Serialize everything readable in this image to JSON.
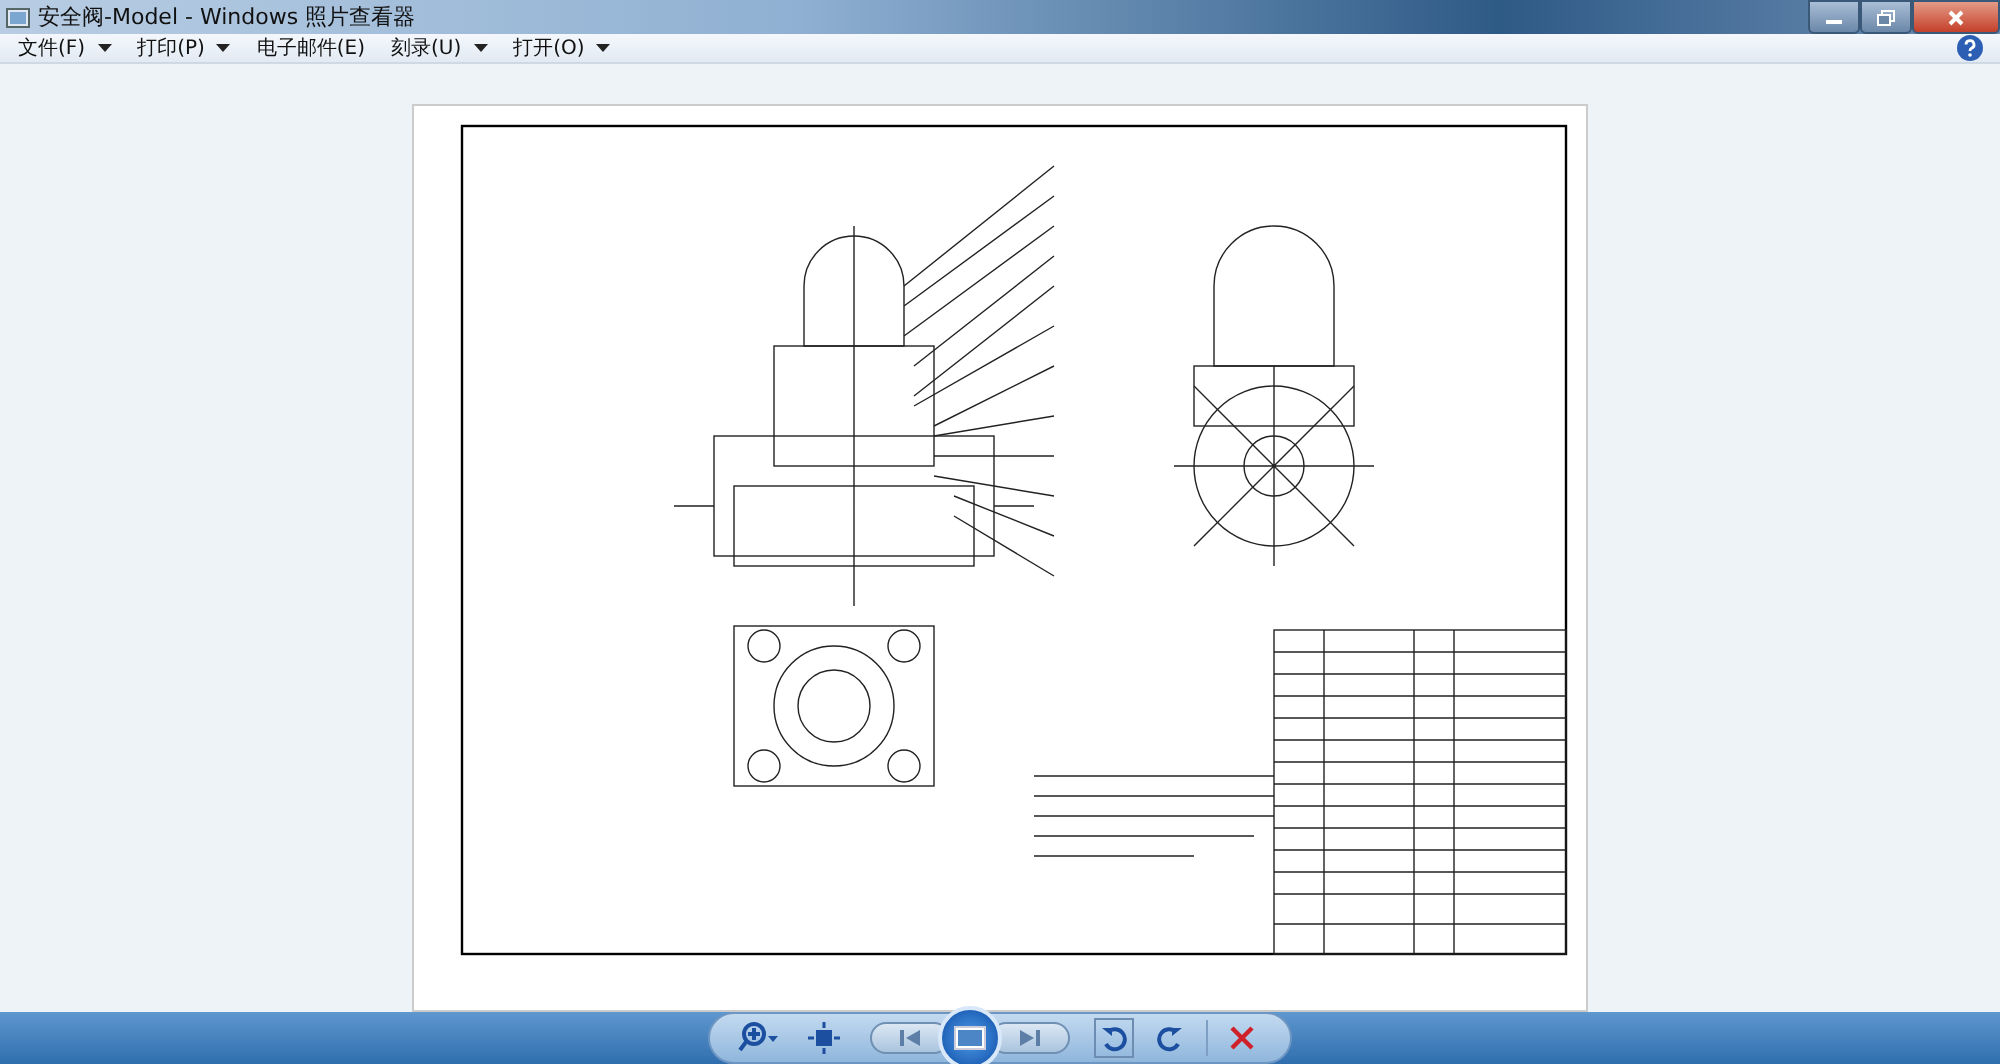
{
  "window": {
    "title": "安全阀-Model - Windows 照片查看器"
  },
  "menu": [
    {
      "label": "文件(F)",
      "dropdown": true
    },
    {
      "label": "打印(P)",
      "dropdown": true
    },
    {
      "label": "电子邮件(E)",
      "dropdown": false
    },
    {
      "label": "刻录(U)",
      "dropdown": true
    },
    {
      "label": "打开(O)",
      "dropdown": true
    }
  ]
}
